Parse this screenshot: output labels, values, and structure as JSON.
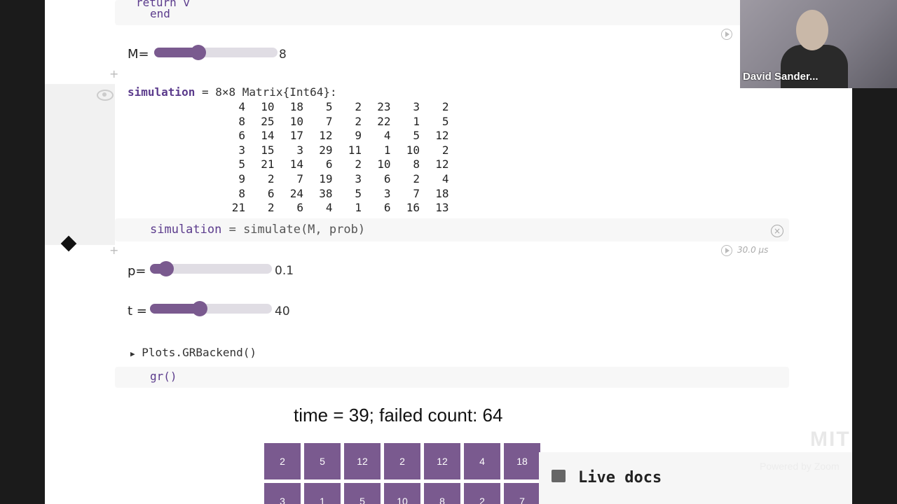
{
  "code_top": {
    "line1": "return v",
    "line2": "end"
  },
  "sliders": {
    "m": {
      "label": "M=",
      "value": "8",
      "fraction": 0.36
    },
    "p": {
      "label": "p=",
      "value": "0.1",
      "fraction": 0.13
    },
    "t": {
      "label": "t =",
      "value": "40",
      "fraction": 0.41
    }
  },
  "matrix": {
    "name": "simulation",
    "type": "= 8×8 Matrix{Int64}:",
    "rows": [
      [
        "4",
        "10",
        "18",
        "5",
        "2",
        "23",
        "3",
        "2"
      ],
      [
        "8",
        "25",
        "10",
        "7",
        "2",
        "22",
        "1",
        "5"
      ],
      [
        "6",
        "14",
        "17",
        "12",
        "9",
        "4",
        "5",
        "12"
      ],
      [
        "3",
        "15",
        "3",
        "29",
        "11",
        "1",
        "10",
        "2"
      ],
      [
        "5",
        "21",
        "14",
        "6",
        "2",
        "10",
        "8",
        "12"
      ],
      [
        "9",
        "2",
        "7",
        "19",
        "3",
        "6",
        "2",
        "4"
      ],
      [
        "8",
        "6",
        "24",
        "38",
        "5",
        "3",
        "7",
        "18"
      ],
      [
        "21",
        "2",
        "6",
        "4",
        "1",
        "6",
        "16",
        "13"
      ]
    ]
  },
  "code_sim": {
    "var": "simulation",
    "rest": " = simulate(M, prob)"
  },
  "run_time": "30.0 μs",
  "backend_output": "Plots.GRBackend()",
  "code_gr": "gr()",
  "plot": {
    "title": "time = 39;  failed count: 64",
    "row1": [
      "2",
      "5",
      "12",
      "2",
      "12",
      "4",
      "18"
    ],
    "row2": [
      "3",
      "1",
      "5",
      "10",
      "8",
      "2",
      "7"
    ]
  },
  "live_docs": "Live docs",
  "webcam": {
    "name": "David Sander..."
  },
  "watermark": {
    "text": "Powered by Zoom",
    "logo": "MIT"
  },
  "colors": {
    "accent": "#7a5a8f",
    "syntax_var": "#5b3b8c"
  }
}
